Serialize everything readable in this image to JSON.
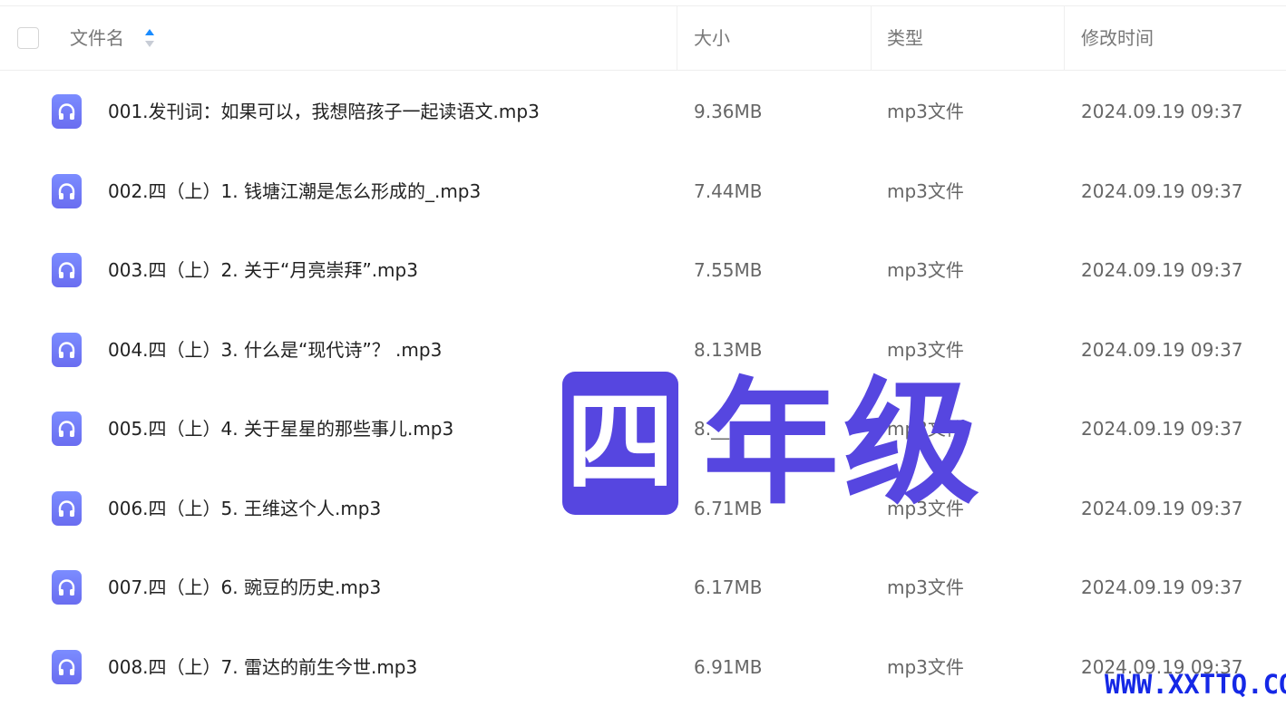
{
  "header": {
    "name_label": "文件名",
    "size_label": "大小",
    "type_label": "类型",
    "time_label": "修改时间"
  },
  "files": [
    {
      "name": "001.发刊词：如果可以，我想陪孩子一起读语文.mp3",
      "size": "9.36MB",
      "type": "mp3文件",
      "time": "2024.09.19 09:37"
    },
    {
      "name": "002.四（上）1. 钱塘江潮是怎么形成的_.mp3",
      "size": "7.44MB",
      "type": "mp3文件",
      "time": "2024.09.19 09:37"
    },
    {
      "name": "003.四（上）2. 关于“月亮崇拜”.mp3",
      "size": "7.55MB",
      "type": "mp3文件",
      "time": "2024.09.19 09:37"
    },
    {
      "name": "004.四（上）3. 什么是“现代诗”？ .mp3",
      "size": "8.13MB",
      "type": "mp3文件",
      "time": "2024.09.19 09:37"
    },
    {
      "name": "005.四（上）4. 关于星星的那些事儿.mp3",
      "size": "8.__MB",
      "type": "mp3文件",
      "time": "2024.09.19 09:37"
    },
    {
      "name": "006.四（上）5. 王维这个人.mp3",
      "size": "6.71MB",
      "type": "mp3文件",
      "time": "2024.09.19 09:37"
    },
    {
      "name": "007.四（上）6. 豌豆的历史.mp3",
      "size": "6.17MB",
      "type": "mp3文件",
      "time": "2024.09.19 09:37"
    },
    {
      "name": "008.四（上）7. 雷达的前生今世.mp3",
      "size": "6.91MB",
      "type": "mp3文件",
      "time": "2024.09.19 09:37"
    }
  ],
  "watermark": {
    "char1": "四",
    "char2": "年",
    "char3": "级",
    "site": "WWW.XXTTQ.COM"
  },
  "colors": {
    "accent": "#1a8cff",
    "icon": "#7078f5",
    "watermark": "#5646e0",
    "site_mark": "#1528e6"
  },
  "icons": {
    "file_icon": "headphones-icon",
    "sort": "sort-icon"
  }
}
